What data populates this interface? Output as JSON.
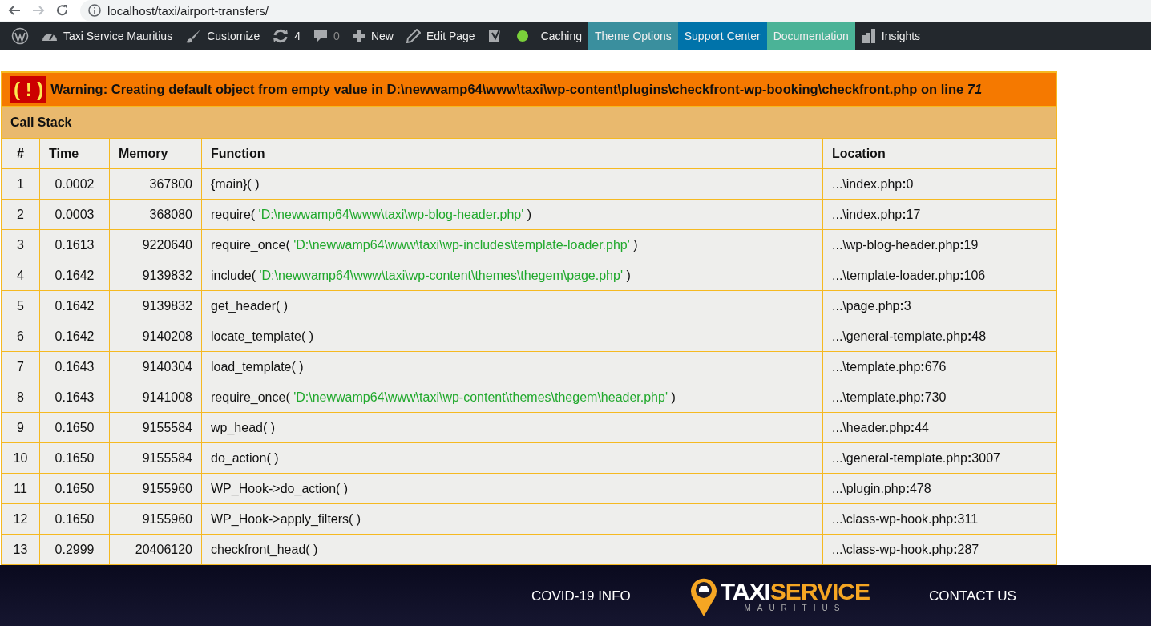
{
  "browser": {
    "url": "localhost/taxi/airport-transfers/"
  },
  "admin_bar": {
    "items": [
      {
        "kind": "icon"
      },
      {
        "kind": "link",
        "label": "Taxi Service Mauritius",
        "muted": false
      },
      {
        "kind": "link",
        "label": "Customize",
        "muted": false
      },
      {
        "kind": "link",
        "label": "4",
        "muted": false
      },
      {
        "kind": "link",
        "label": "0",
        "muted": true
      },
      {
        "kind": "link",
        "label": "New",
        "muted": false
      },
      {
        "kind": "link",
        "label": "Edit Page",
        "muted": false
      },
      {
        "kind": "icon"
      },
      {
        "kind": "icon"
      },
      {
        "kind": "link",
        "label": "Caching",
        "muted": false
      },
      {
        "kind": "link",
        "label": "Theme Options",
        "muted": false,
        "color": "#3a8f9e"
      },
      {
        "kind": "link",
        "label": "Support Center",
        "muted": false,
        "color": "#0073aa"
      },
      {
        "kind": "link",
        "label": "Documentation",
        "muted": false,
        "color": "#4bb397"
      },
      {
        "kind": "link",
        "label": "Insights",
        "muted": false
      }
    ]
  },
  "error": {
    "icon_text": "( ! )",
    "message": "Warning: Creating default object from empty value in D:\\newwamp64\\www\\taxi\\wp-content\\plugins\\checkfront-wp-booking\\checkfront.php on line *71*",
    "section": "Call Stack",
    "columns": [
      "#",
      "Time",
      "Memory",
      "Function",
      "Location"
    ],
    "rows": [
      {
        "num": "1",
        "time": "0.0002",
        "memory": "367800",
        "function": "{main}( )",
        "location": "...\\index.php**:**0"
      },
      {
        "num": "2",
        "time": "0.0003",
        "memory": "368080",
        "function": "require( 'D:\\newwamp64\\www\\taxi\\wp-blog-header.php' )",
        "location": "...\\index.php**:**17"
      },
      {
        "num": "3",
        "time": "0.1613",
        "memory": "9220640",
        "function": "require_once( 'D:\\newwamp64\\www\\taxi\\wp-includes\\template-loader.php' )",
        "location": "...\\wp-blog-header.php**:**19"
      },
      {
        "num": "4",
        "time": "0.1642",
        "memory": "9139832",
        "function": "include( 'D:\\newwamp64\\www\\taxi\\wp-content\\themes\\thegem\\page.php' )",
        "location": "...\\template-loader.php**:**106"
      },
      {
        "num": "5",
        "time": "0.1642",
        "memory": "9139832",
        "function": "get_header( )",
        "location": "...\\page.php**:**3"
      },
      {
        "num": "6",
        "time": "0.1642",
        "memory": "9140208",
        "function": "locate_template( )",
        "location": "...\\general-template.php**:**48"
      },
      {
        "num": "7",
        "time": "0.1643",
        "memory": "9140304",
        "function": "load_template( )",
        "location": "...\\template.php**:**676"
      },
      {
        "num": "8",
        "time": "0.1643",
        "memory": "9141008",
        "function": "require_once( 'D:\\newwamp64\\www\\taxi\\wp-content\\themes\\thegem\\header.php' )",
        "location": "...\\template.php**:**730"
      },
      {
        "num": "9",
        "time": "0.1650",
        "memory": "9155584",
        "function": "wp_head( )",
        "location": "...\\header.php**:**44"
      },
      {
        "num": "10",
        "time": "0.1650",
        "memory": "9155584",
        "function": "do_action( )",
        "location": "...\\general-template.php**:**3007"
      },
      {
        "num": "11",
        "time": "0.1650",
        "memory": "9155960",
        "function": "WP_Hook->do_action( )",
        "location": "...\\plugin.php**:**478"
      },
      {
        "num": "12",
        "time": "0.1650",
        "memory": "9155960",
        "function": "WP_Hook->apply_filters( )",
        "location": "...\\class-wp-hook.php**:**311"
      },
      {
        "num": "13",
        "time": "0.2999",
        "memory": "20406120",
        "function": "checkfront_head( )",
        "location": "...\\class-wp-hook.php**:**287"
      }
    ]
  },
  "footer": {
    "links": [
      "COVID-19 INFO",
      "CONTACT US"
    ],
    "logo": {
      "word_1": "TAXI",
      "word_2": "SERVICE",
      "tagline": "MAURITIUS"
    }
  }
}
